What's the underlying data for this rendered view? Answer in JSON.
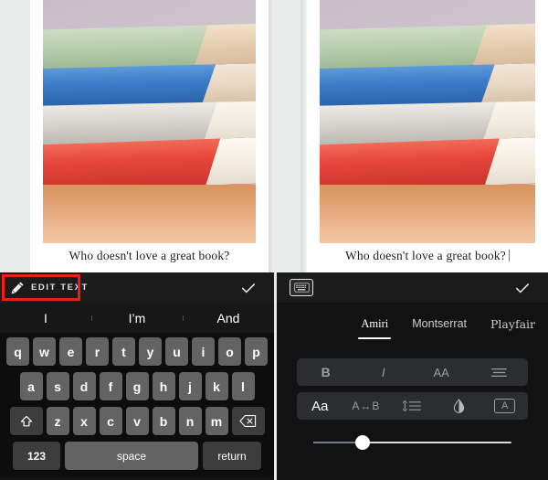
{
  "left_panel": {
    "caption": "Who doesn't love a great book?",
    "toolbar": {
      "edit_text_label": "EDIT TEXT",
      "pencil_icon": "pencil-icon",
      "confirm_icon": "checkmark-icon",
      "highlight_color": "#f41c0a"
    },
    "suggestions": [
      "I",
      "I’m",
      "And"
    ],
    "keyboard": {
      "row1": [
        "q",
        "w",
        "e",
        "r",
        "t",
        "y",
        "u",
        "i",
        "o",
        "p"
      ],
      "row2": [
        "a",
        "s",
        "d",
        "f",
        "g",
        "h",
        "j",
        "k",
        "l"
      ],
      "row3": [
        "z",
        "x",
        "c",
        "v",
        "b",
        "n",
        "m"
      ],
      "shift_icon": "shift-arrow-icon",
      "backspace_icon": "backspace-icon",
      "numbers_label": "123",
      "space_label": "space",
      "return_label": "return"
    }
  },
  "right_panel": {
    "caption": "Who doesn't love a great book?",
    "caret_visible": true,
    "toolbar": {
      "keyboard_icon": "keyboard-icon",
      "confirm_icon": "checkmark-icon"
    },
    "fonts": [
      {
        "label": "Amiri",
        "selected": true
      },
      {
        "label": "Montserrat",
        "selected": false
      },
      {
        "label": "Playfair",
        "selected": false
      }
    ],
    "format_row_1": [
      {
        "name": "bold-tool",
        "label": "B",
        "active": false
      },
      {
        "name": "italic-tool",
        "label": "I",
        "active": false
      },
      {
        "name": "caps-tool",
        "label": "AA",
        "active": false
      },
      {
        "name": "align-tool",
        "label": "",
        "active": false
      }
    ],
    "format_row_2": [
      {
        "name": "font-size-tool",
        "label": "Aa",
        "active": true
      },
      {
        "name": "letter-spacing-tool",
        "label": "A↔B",
        "active": false
      },
      {
        "name": "line-height-tool",
        "label": "",
        "active": false
      },
      {
        "name": "opacity-tool",
        "label": "",
        "active": false
      },
      {
        "name": "text-background-tool",
        "label": "A",
        "active": false
      }
    ],
    "slider": {
      "name": "font-size-slider",
      "value_percent": 25
    }
  },
  "photo": {
    "alt": "stack-of-books",
    "colors": {
      "background": "#c9bcc9",
      "book_green": "#b9cfae",
      "book_blue": "#3c7ec9",
      "book_white": "#d8d5cf",
      "book_red": "#e8463a",
      "table": "#e3a476"
    }
  }
}
